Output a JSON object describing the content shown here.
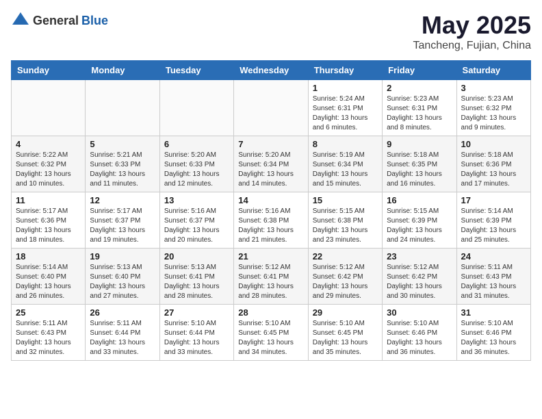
{
  "header": {
    "logo_general": "General",
    "logo_blue": "Blue",
    "month_title": "May 2025",
    "location": "Tancheng, Fujian, China"
  },
  "weekdays": [
    "Sunday",
    "Monday",
    "Tuesday",
    "Wednesday",
    "Thursday",
    "Friday",
    "Saturday"
  ],
  "weeks": [
    [
      {
        "day": "",
        "info": ""
      },
      {
        "day": "",
        "info": ""
      },
      {
        "day": "",
        "info": ""
      },
      {
        "day": "",
        "info": ""
      },
      {
        "day": "1",
        "info": "Sunrise: 5:24 AM\nSunset: 6:31 PM\nDaylight: 13 hours\nand 6 minutes."
      },
      {
        "day": "2",
        "info": "Sunrise: 5:23 AM\nSunset: 6:31 PM\nDaylight: 13 hours\nand 8 minutes."
      },
      {
        "day": "3",
        "info": "Sunrise: 5:23 AM\nSunset: 6:32 PM\nDaylight: 13 hours\nand 9 minutes."
      }
    ],
    [
      {
        "day": "4",
        "info": "Sunrise: 5:22 AM\nSunset: 6:32 PM\nDaylight: 13 hours\nand 10 minutes."
      },
      {
        "day": "5",
        "info": "Sunrise: 5:21 AM\nSunset: 6:33 PM\nDaylight: 13 hours\nand 11 minutes."
      },
      {
        "day": "6",
        "info": "Sunrise: 5:20 AM\nSunset: 6:33 PM\nDaylight: 13 hours\nand 12 minutes."
      },
      {
        "day": "7",
        "info": "Sunrise: 5:20 AM\nSunset: 6:34 PM\nDaylight: 13 hours\nand 14 minutes."
      },
      {
        "day": "8",
        "info": "Sunrise: 5:19 AM\nSunset: 6:34 PM\nDaylight: 13 hours\nand 15 minutes."
      },
      {
        "day": "9",
        "info": "Sunrise: 5:18 AM\nSunset: 6:35 PM\nDaylight: 13 hours\nand 16 minutes."
      },
      {
        "day": "10",
        "info": "Sunrise: 5:18 AM\nSunset: 6:36 PM\nDaylight: 13 hours\nand 17 minutes."
      }
    ],
    [
      {
        "day": "11",
        "info": "Sunrise: 5:17 AM\nSunset: 6:36 PM\nDaylight: 13 hours\nand 18 minutes."
      },
      {
        "day": "12",
        "info": "Sunrise: 5:17 AM\nSunset: 6:37 PM\nDaylight: 13 hours\nand 19 minutes."
      },
      {
        "day": "13",
        "info": "Sunrise: 5:16 AM\nSunset: 6:37 PM\nDaylight: 13 hours\nand 20 minutes."
      },
      {
        "day": "14",
        "info": "Sunrise: 5:16 AM\nSunset: 6:38 PM\nDaylight: 13 hours\nand 21 minutes."
      },
      {
        "day": "15",
        "info": "Sunrise: 5:15 AM\nSunset: 6:38 PM\nDaylight: 13 hours\nand 23 minutes."
      },
      {
        "day": "16",
        "info": "Sunrise: 5:15 AM\nSunset: 6:39 PM\nDaylight: 13 hours\nand 24 minutes."
      },
      {
        "day": "17",
        "info": "Sunrise: 5:14 AM\nSunset: 6:39 PM\nDaylight: 13 hours\nand 25 minutes."
      }
    ],
    [
      {
        "day": "18",
        "info": "Sunrise: 5:14 AM\nSunset: 6:40 PM\nDaylight: 13 hours\nand 26 minutes."
      },
      {
        "day": "19",
        "info": "Sunrise: 5:13 AM\nSunset: 6:40 PM\nDaylight: 13 hours\nand 27 minutes."
      },
      {
        "day": "20",
        "info": "Sunrise: 5:13 AM\nSunset: 6:41 PM\nDaylight: 13 hours\nand 28 minutes."
      },
      {
        "day": "21",
        "info": "Sunrise: 5:12 AM\nSunset: 6:41 PM\nDaylight: 13 hours\nand 28 minutes."
      },
      {
        "day": "22",
        "info": "Sunrise: 5:12 AM\nSunset: 6:42 PM\nDaylight: 13 hours\nand 29 minutes."
      },
      {
        "day": "23",
        "info": "Sunrise: 5:12 AM\nSunset: 6:42 PM\nDaylight: 13 hours\nand 30 minutes."
      },
      {
        "day": "24",
        "info": "Sunrise: 5:11 AM\nSunset: 6:43 PM\nDaylight: 13 hours\nand 31 minutes."
      }
    ],
    [
      {
        "day": "25",
        "info": "Sunrise: 5:11 AM\nSunset: 6:43 PM\nDaylight: 13 hours\nand 32 minutes."
      },
      {
        "day": "26",
        "info": "Sunrise: 5:11 AM\nSunset: 6:44 PM\nDaylight: 13 hours\nand 33 minutes."
      },
      {
        "day": "27",
        "info": "Sunrise: 5:10 AM\nSunset: 6:44 PM\nDaylight: 13 hours\nand 33 minutes."
      },
      {
        "day": "28",
        "info": "Sunrise: 5:10 AM\nSunset: 6:45 PM\nDaylight: 13 hours\nand 34 minutes."
      },
      {
        "day": "29",
        "info": "Sunrise: 5:10 AM\nSunset: 6:45 PM\nDaylight: 13 hours\nand 35 minutes."
      },
      {
        "day": "30",
        "info": "Sunrise: 5:10 AM\nSunset: 6:46 PM\nDaylight: 13 hours\nand 36 minutes."
      },
      {
        "day": "31",
        "info": "Sunrise: 5:10 AM\nSunset: 6:46 PM\nDaylight: 13 hours\nand 36 minutes."
      }
    ]
  ]
}
